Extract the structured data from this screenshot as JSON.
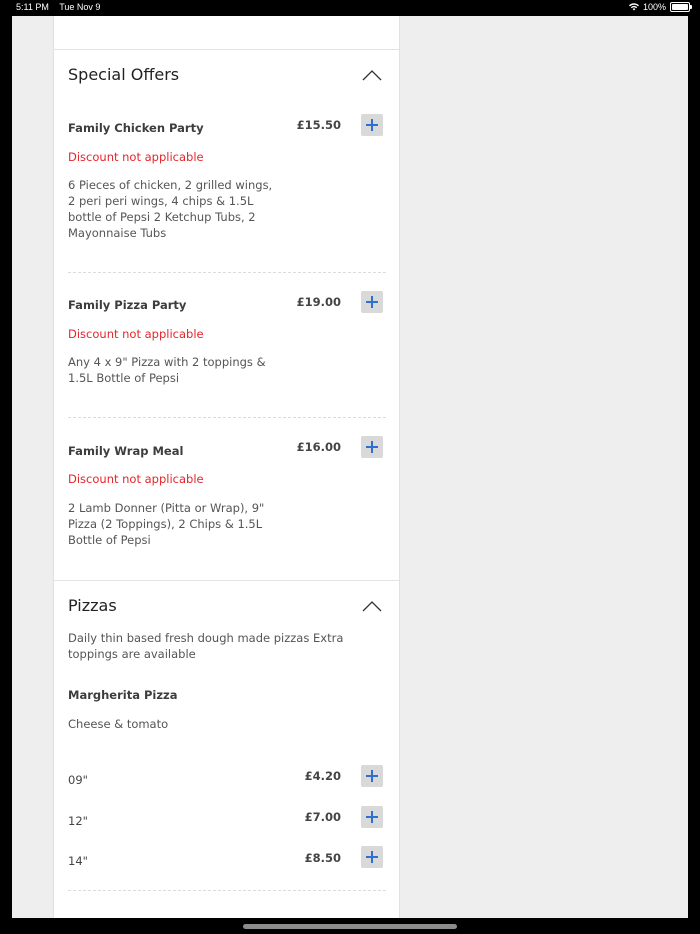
{
  "status_bar": {
    "time": "5:11 PM",
    "date": "Tue Nov 9",
    "battery": "100%"
  },
  "sections": {
    "special_offers": {
      "title": "Special Offers",
      "items": [
        {
          "name": "Family Chicken Party",
          "price": "£15.50",
          "discount": "Discount not applicable",
          "description": "6 Pieces of chicken, 2 grilled wings, 2 peri peri wings, 4 chips & 1.5L bottle of Pepsi 2 Ketchup Tubs, 2 Mayonnaise Tubs"
        },
        {
          "name": "Family Pizza Party",
          "price": "£19.00",
          "discount": "Discount not applicable",
          "description": "Any 4 x 9\" Pizza with 2 toppings & 1.5L Bottle of Pepsi"
        },
        {
          "name": "Family Wrap Meal",
          "price": "£16.00",
          "discount": "Discount not applicable",
          "description": "2 Lamb Donner (Pitta or Wrap), 9\" Pizza (2 Toppings), 2 Chips & 1.5L Bottle of Pepsi"
        }
      ]
    },
    "pizzas": {
      "title": "Pizzas",
      "description": "Daily thin based fresh dough made pizzas Extra toppings are available",
      "item": {
        "name": "Margherita Pizza",
        "description": "Cheese & tomato",
        "sizes": [
          {
            "label": "09\"",
            "price": "£4.20"
          },
          {
            "label": "12\"",
            "price": "£7.00"
          },
          {
            "label": "14\"",
            "price": "£8.50"
          }
        ]
      }
    }
  },
  "colors": {
    "accent": "#2f6fd1",
    "discount": "#e4262c",
    "button_bg": "#d9d9d9"
  },
  "icons": {
    "expand": "chevron-up-icon",
    "add": "plus-icon"
  }
}
